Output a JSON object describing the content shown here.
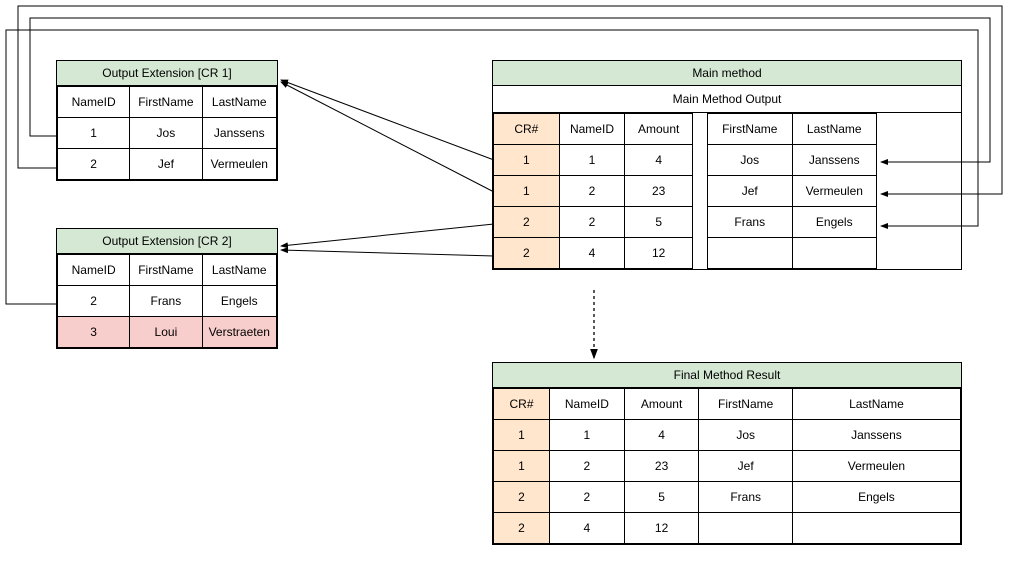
{
  "colors": {
    "titleBg": "#D5E8D4",
    "crBg": "#FFE6CC",
    "highlightBg": "#F8CECC"
  },
  "ext1": {
    "title": "Output Extension [CR 1]",
    "headers": [
      "NameID",
      "FirstName",
      "LastName"
    ],
    "rows": [
      [
        "1",
        "Jos",
        "Janssens"
      ],
      [
        "2",
        "Jef",
        "Vermeulen"
      ]
    ]
  },
  "ext2": {
    "title": "Output Extension [CR 2]",
    "headers": [
      "NameID",
      "FirstName",
      "LastName"
    ],
    "rows": [
      [
        "2",
        "Frans",
        "Engels"
      ],
      [
        "3",
        "Loui",
        "Verstraeten"
      ]
    ],
    "highlightedRowIndex": 1
  },
  "main": {
    "title": "Main method",
    "outputTitle": "Main Method Output",
    "leftHeaders": [
      "CR#",
      "NameID",
      "Amount"
    ],
    "leftRows": [
      [
        "1",
        "1",
        "4"
      ],
      [
        "1",
        "2",
        "23"
      ],
      [
        "2",
        "2",
        "5"
      ],
      [
        "2",
        "4",
        "12"
      ]
    ],
    "rightHeaders": [
      "FirstName",
      "LastName"
    ],
    "rightRows": [
      [
        "Jos",
        "Janssens"
      ],
      [
        "Jef",
        "Vermeulen"
      ],
      [
        "Frans",
        "Engels"
      ],
      [
        "",
        ""
      ]
    ]
  },
  "final": {
    "title": "Final Method Result",
    "headers": [
      "CR#",
      "NameID",
      "Amount",
      "FirstName",
      "LastName"
    ],
    "rows": [
      [
        "1",
        "1",
        "4",
        "Jos",
        "Janssens"
      ],
      [
        "1",
        "2",
        "23",
        "Jef",
        "Vermeulen"
      ],
      [
        "2",
        "2",
        "5",
        "Frans",
        "Engels"
      ],
      [
        "2",
        "4",
        "12",
        "",
        ""
      ]
    ]
  }
}
